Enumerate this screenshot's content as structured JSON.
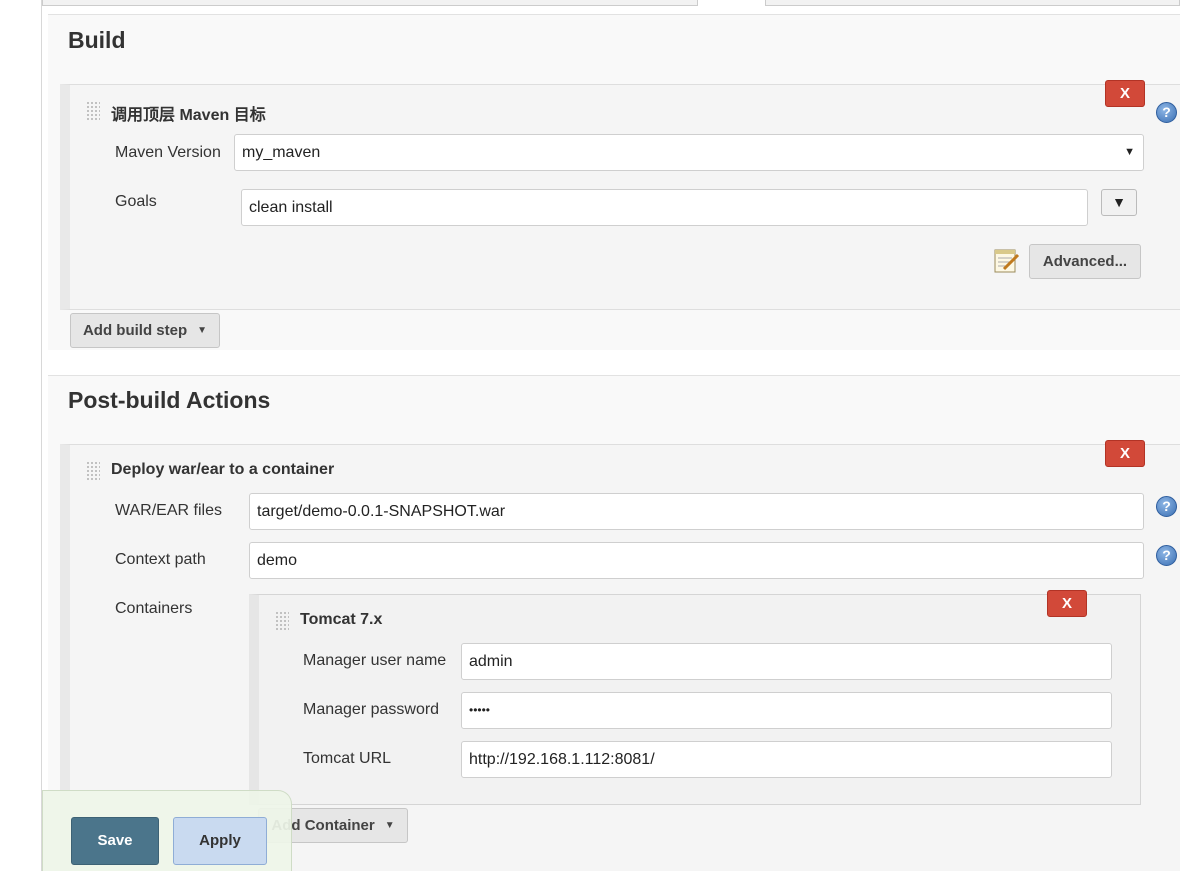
{
  "build": {
    "title": "Build",
    "step": {
      "title": "调用顶层 Maven 目标",
      "delete_label": "X",
      "maven_version_label": "Maven Version",
      "maven_version_value": "my_maven",
      "goals_label": "Goals",
      "goals_value": "clean install",
      "expand_glyph": "▼",
      "advanced_label": "Advanced..."
    },
    "add_step_label": "Add build step"
  },
  "post_build": {
    "title": "Post-build Actions",
    "step": {
      "title": "Deploy war/ear to a container",
      "delete_label": "X",
      "war_label": "WAR/EAR files",
      "war_value": "target/demo-0.0.1-SNAPSHOT.war",
      "context_label": "Context path",
      "context_value": "demo",
      "containers_label": "Containers",
      "container": {
        "title": "Tomcat 7.x",
        "delete_label": "X",
        "user_label": "Manager user name",
        "user_value": "admin",
        "password_label": "Manager password",
        "password_value": "•••••",
        "url_label": "Tomcat URL",
        "url_value": "http://192.168.1.112:8081/"
      },
      "add_container_label": "Add Container"
    }
  },
  "footer": {
    "save_label": "Save",
    "apply_label": "Apply"
  },
  "help_glyph": "?",
  "colors": {
    "delete_red": "#d24939",
    "save_blue": "#4b758b",
    "apply_blue": "#c9daf0"
  }
}
